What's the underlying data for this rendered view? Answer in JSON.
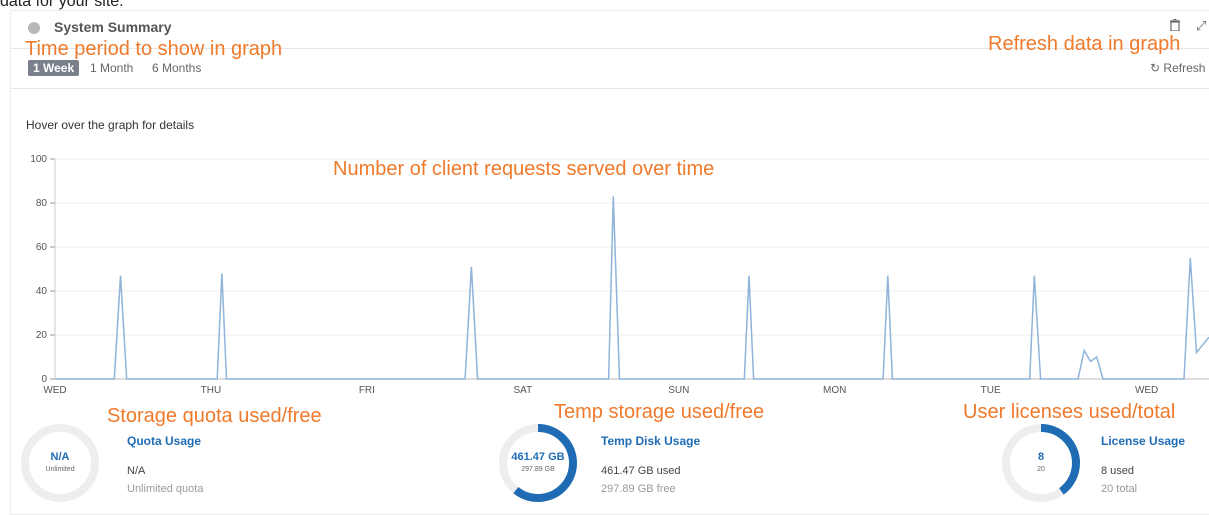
{
  "page": {
    "top_text": "data for your site."
  },
  "header": {
    "title": "System Summary"
  },
  "tabs": [
    {
      "label": "1 Week",
      "active": true
    },
    {
      "label": "1 Month",
      "active": false
    },
    {
      "label": "6 Months",
      "active": false
    }
  ],
  "toolbar": {
    "refresh_label": "Refresh",
    "refresh_icon": "↻"
  },
  "chart_hint": "Hover over the graph for details",
  "annotations": {
    "time_period": "Time period to show in graph",
    "refresh": "Refresh data in graph",
    "chart": "Number of client requests served over time",
    "quota": "Storage quota used/free",
    "temp": "Temp storage used/free",
    "licenses": "User licenses used/total"
  },
  "chart_data": {
    "type": "line",
    "ylim": [
      0,
      100
    ],
    "yticks": [
      0,
      20,
      40,
      60,
      80,
      100
    ],
    "xlim": [
      0,
      7.4
    ],
    "xticks": [
      {
        "x": 0,
        "label": "WED"
      },
      {
        "x": 1,
        "label": "THU"
      },
      {
        "x": 2,
        "label": "FRI"
      },
      {
        "x": 3,
        "label": "SAT"
      },
      {
        "x": 4,
        "label": "SUN"
      },
      {
        "x": 5,
        "label": "MON"
      },
      {
        "x": 6,
        "label": "TUE"
      },
      {
        "x": 7,
        "label": "WED"
      }
    ],
    "color": "#8fb3d9",
    "points": [
      [
        0,
        0
      ],
      [
        0.38,
        0
      ],
      [
        0.42,
        47
      ],
      [
        0.46,
        0
      ],
      [
        1.04,
        0
      ],
      [
        1.07,
        48
      ],
      [
        1.1,
        0
      ],
      [
        2.63,
        0
      ],
      [
        2.67,
        51
      ],
      [
        2.71,
        0
      ],
      [
        3.55,
        0
      ],
      [
        3.58,
        83
      ],
      [
        3.62,
        0
      ],
      [
        4.42,
        0
      ],
      [
        4.45,
        47
      ],
      [
        4.48,
        0
      ],
      [
        5.31,
        0
      ],
      [
        5.34,
        47
      ],
      [
        5.37,
        0
      ],
      [
        6.25,
        0
      ],
      [
        6.28,
        47
      ],
      [
        6.32,
        0
      ],
      [
        6.56,
        0
      ],
      [
        6.6,
        13
      ],
      [
        6.64,
        8
      ],
      [
        6.68,
        10
      ],
      [
        6.72,
        0
      ],
      [
        7.24,
        0
      ],
      [
        7.28,
        55
      ],
      [
        7.32,
        12
      ],
      [
        7.4,
        19
      ]
    ]
  },
  "quota": {
    "title": "Quota Usage",
    "ring_value": "N/A",
    "ring_sub": "Unlimited",
    "line1": "N/A",
    "line2": "Unlimited quota",
    "fraction": 0
  },
  "temp": {
    "title": "Temp Disk Usage",
    "ring_value": "461.47 GB",
    "ring_sub": "297.89 GB",
    "line1": "461.47 GB used",
    "line2": "297.89 GB free",
    "fraction": 0.608
  },
  "license": {
    "title": "License Usage",
    "ring_value": "8",
    "ring_sub": "20",
    "line1": "8 used",
    "line2": "20 total",
    "fraction": 0.4
  },
  "colors": {
    "accent": "#1f6cb5",
    "ring_track": "#eeeeee",
    "annotation": "#f07a2b"
  }
}
